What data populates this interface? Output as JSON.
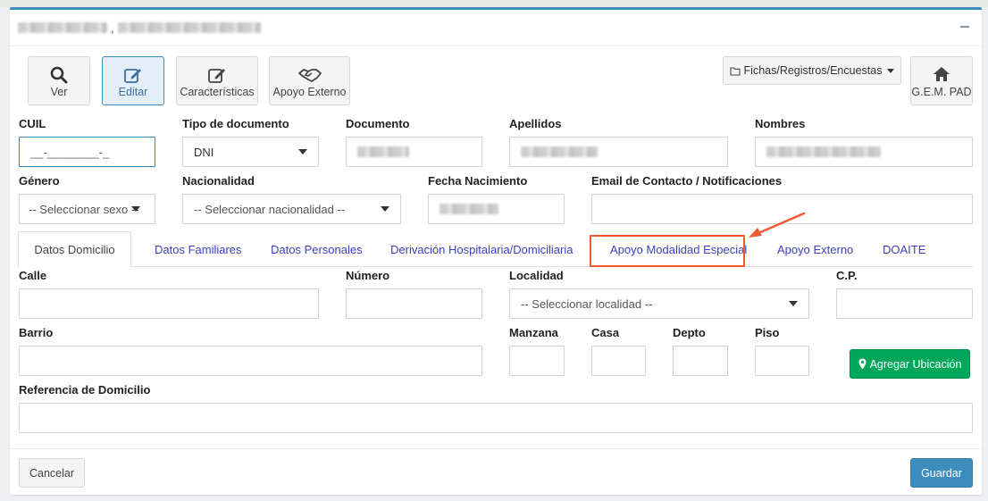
{
  "toolbar": {
    "ver_label": "Ver",
    "editar_label": "Editar",
    "caracteristicas_label": "Características",
    "apoyo_externo_label": "Apoyo Externo",
    "fichas_label": "Fichas/Registros/Encuestas",
    "gem_pad_label": "G.E.M. PAD"
  },
  "form": {
    "cuil_label": "CUIL",
    "cuil_placeholder": "__-________-_",
    "tipo_doc_label": "Tipo de documento",
    "tipo_doc_value": "DNI",
    "documento_label": "Documento",
    "apellidos_label": "Apellidos",
    "nombres_label": "Nombres",
    "genero_label": "Género",
    "genero_value": "-- Seleccionar sexo --",
    "nacionalidad_label": "Nacionalidad",
    "nacionalidad_value": "-- Seleccionar nacionalidad --",
    "fecha_label": "Fecha Nacimiento",
    "email_label": "Email de Contacto / Notificaciones"
  },
  "tabs": [
    {
      "label": "Datos Domicilio"
    },
    {
      "label": "Datos Familiares"
    },
    {
      "label": "Datos Personales"
    },
    {
      "label": "Derivación Hospitalaria/Domiciliaria"
    },
    {
      "label": "Apoyo Modalidad Especial"
    },
    {
      "label": "Apoyo Externo"
    },
    {
      "label": "DOAITE"
    }
  ],
  "domicilio": {
    "calle_label": "Calle",
    "numero_label": "Número",
    "localidad_label": "Localidad",
    "localidad_value": "-- Seleccionar localidad --",
    "cp_label": "C.P.",
    "barrio_label": "Barrio",
    "manzana_label": "Manzana",
    "casa_label": "Casa",
    "depto_label": "Depto",
    "piso_label": "Piso",
    "agregar_label": "Agregar Ubicación",
    "referencia_label": "Referencia de Domicilio"
  },
  "footer": {
    "cancelar_label": "Cancelar",
    "guardar_label": "Guardar"
  },
  "colors": {
    "primary": "#3c8dbc",
    "success": "#00a65a",
    "highlight": "#f05a32",
    "tab_link": "#3c3fc0"
  }
}
